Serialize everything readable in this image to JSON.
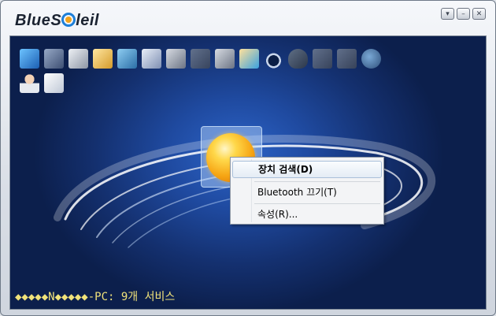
{
  "app": {
    "brand_left": "BlueS",
    "brand_right": "leil"
  },
  "window_buttons": {
    "menu": "▾",
    "minimize": "–",
    "close": "✕"
  },
  "toolbar_icons": [
    "network-access-icon",
    "lan-access-icon",
    "fax-icon",
    "file-transfer-icon",
    "sync-icon",
    "business-card-icon",
    "printer-icon",
    "mouse-icon",
    "fax-machine-icon",
    "image-icon",
    "headset-icon",
    "headset-hook-icon",
    "serial-port-icon",
    "serial-port-2-icon",
    "globe-icon",
    "personal-area-network-icon",
    "object-push-icon"
  ],
  "status_text": "◆◆◆◆◆N◆◆◆◆◆-PC: 9개 서비스",
  "context_menu": {
    "items": [
      {
        "label": "장치 검색(D)"
      },
      {
        "label": "Bluetooth 끄기(T)"
      },
      {
        "label": "속성(R)..."
      }
    ]
  },
  "colors": {
    "background_blue": "#1f4aa0",
    "status_yellow": "#f0e27a",
    "accent_orange": "#f6a514"
  }
}
